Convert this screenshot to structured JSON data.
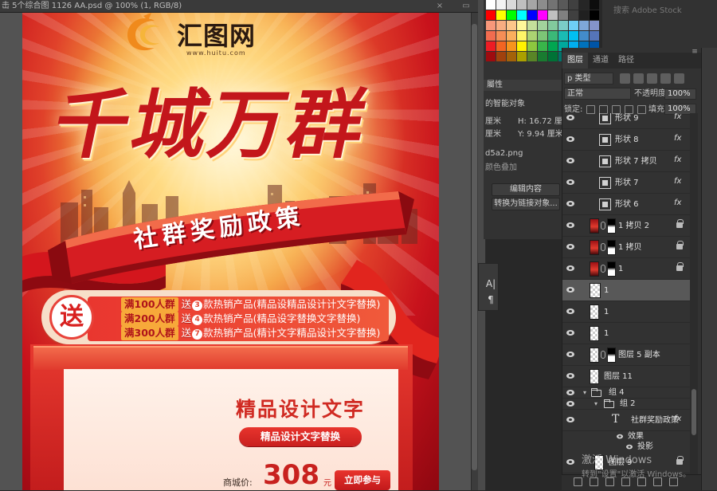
{
  "document": {
    "tab_title": "击 5个综合图 1126 AA.psd @ 100% (1, RGB/8)",
    "close_glyph": "×"
  },
  "poster": {
    "logo_text": "汇图网",
    "logo_url": "www.huitu.com",
    "headline": "千城万群",
    "ribbon_text": "社群奖励政策",
    "promo_badge": "送",
    "promo_rows": [
      {
        "tag": "满100人群",
        "pre": "送",
        "num": "3",
        "post": "款热销产品(精品设精品设计计文字替换)"
      },
      {
        "tag": "满200人群",
        "pre": "送",
        "num": "4",
        "post": "款热销产品(精品设字替换文字替换)"
      },
      {
        "tag": "满300人群",
        "pre": "送",
        "num": "7",
        "post": "款热销产品(精计文字精品设计文字替换)"
      }
    ],
    "card_title": "精品设计文字",
    "card_pill": "精品设计文字替换",
    "price_label": "商城价:",
    "price_value": "308",
    "price_unit": "元",
    "join_button": "立即参与"
  },
  "properties": {
    "line_smart": "的智能对象",
    "w_label": "厘米",
    "w_h_text": "H:  16.72 厘米",
    "h_label": "厘米",
    "h_y_text": "Y:  9.94 厘米",
    "file_name": "d5a2.png",
    "header": "屬性",
    "lib_search": "搜索 Adobe Stock",
    "color_overlay": "颜色叠加",
    "edit_contents": "编辑内容",
    "convert_link": "转换为链接对象..."
  },
  "character_dock": {
    "icon_1": "A|",
    "icon_2": "¶"
  },
  "layers": {
    "tabs": [
      "图层",
      "通道",
      "路径"
    ],
    "active_tab": "图层",
    "menu_glyph": "≡",
    "filter_kind": "p 类型",
    "blend_mode": "正常",
    "opacity_label": "不透明度:",
    "opacity_value": "100%",
    "lock_label": "锁定:",
    "fill_label": "填充:",
    "fill_value": "100%",
    "rows": [
      {
        "name": "形状 9"
      },
      {
        "name": "形状 8"
      },
      {
        "name": "形状 7 拷贝"
      },
      {
        "name": "形状 7"
      },
      {
        "name": "形状 6"
      },
      {
        "name": "1 拷贝 2"
      },
      {
        "name": "1 拷贝"
      },
      {
        "name": "1"
      },
      {
        "name": "1"
      },
      {
        "name": "1"
      },
      {
        "name": "1"
      },
      {
        "name": "图层 5 副本"
      },
      {
        "name": "图层 11"
      },
      {
        "name": "组 4"
      },
      {
        "name": "组 2"
      },
      {
        "name": "社群奖励政策"
      },
      {
        "name": "效果"
      },
      {
        "name": "投影"
      },
      {
        "name": "图层 9"
      }
    ],
    "fx_glyph": "fx"
  },
  "watermark": {
    "line1": "激活 Windows",
    "line2": "转到\"设置\"以激活 Windows。"
  },
  "colors": {
    "brand_red": "#c3161b",
    "accent_orange": "#f7a93a",
    "ps_panel": "#323232",
    "ps_selected": "#585858"
  }
}
